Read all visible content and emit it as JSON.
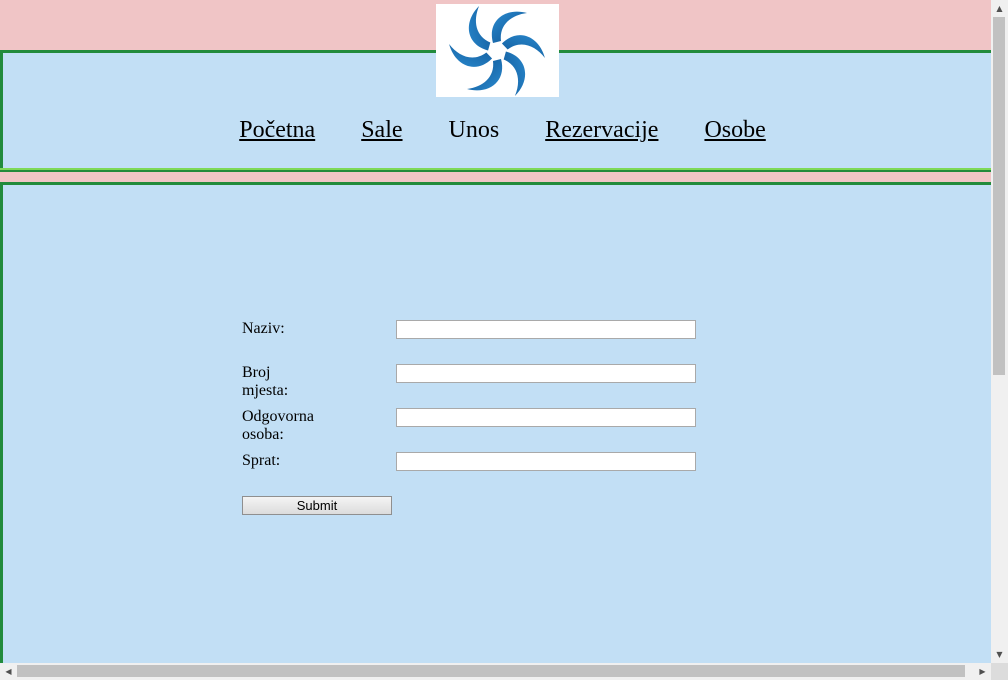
{
  "nav": {
    "items": [
      {
        "label": "Početna"
      },
      {
        "label": "Sale"
      },
      {
        "label": "Unos"
      },
      {
        "label": "Rezervacije"
      },
      {
        "label": "Osobe"
      }
    ]
  },
  "logo": {
    "icon": "spiral-logo-icon"
  },
  "form": {
    "fields": [
      {
        "label": "Naziv:",
        "value": ""
      },
      {
        "label": "Broj mjesta:",
        "value": ""
      },
      {
        "label": "Odgovorna osoba:",
        "value": ""
      },
      {
        "label": "Sprat:",
        "value": ""
      }
    ],
    "submit_label": "Submit"
  },
  "colors": {
    "page_background": "#f0c5c6",
    "panel_background": "#c2dff5",
    "border_green": "#228b3c",
    "accent_light_green": "#7ed957",
    "logo_blue": "#1a6fb5"
  }
}
